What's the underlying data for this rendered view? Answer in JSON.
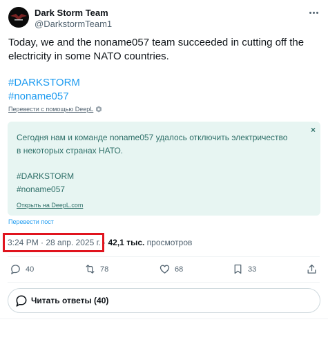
{
  "author": {
    "name": "Dark Storm Team",
    "handle": "@DarkstormTeam1"
  },
  "tweet": {
    "text": "Today, we and the noname057 team succeeded in cutting off the electricity in some NATO countries.",
    "hashtags": [
      "#DARKSTORM",
      "#noname057"
    ],
    "translate_via_deepl": "Перевести с помощью DeepL"
  },
  "translation": {
    "text": "Сегодня нам и команде noname057 удалось отключить электричество в некоторых странах НАТО.",
    "hashtags": [
      "#DARKSTORM",
      "#noname057"
    ],
    "open_deepl": "Открыть на DeepL.com",
    "close_symbol": "×"
  },
  "translate_post": "Перевести пост",
  "meta": {
    "timestamp": "3:24 PM · 28 апр. 2025 г.",
    "separator": " · ",
    "views_count": "42,1 тыс.",
    "views_label": " просмотров"
  },
  "actions": {
    "replies": "40",
    "reposts": "78",
    "likes": "68",
    "bookmarks": "33"
  },
  "read_replies": "Читать ответы (40)",
  "colors": {
    "accent": "#1d9bf0",
    "translation_bg": "#e7f5f2",
    "translation_text": "#2e6f68",
    "highlight": "#e0141e"
  }
}
